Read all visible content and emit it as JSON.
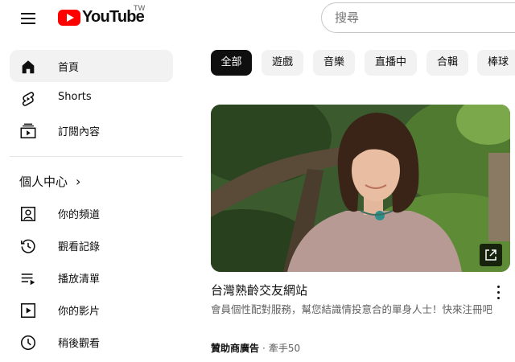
{
  "header": {
    "logo_text": "YouTube",
    "region": "TW",
    "search_placeholder": "搜尋"
  },
  "sidebar": {
    "items": [
      {
        "label": "首頁",
        "icon": "home-icon",
        "active": true
      },
      {
        "label": "Shorts",
        "icon": "shorts-icon",
        "active": false
      },
      {
        "label": "訂閱內容",
        "icon": "subscriptions-icon",
        "active": false
      }
    ],
    "you_heading": "個人中心",
    "you_items": [
      {
        "label": "你的頻道",
        "icon": "your-channel-icon"
      },
      {
        "label": "觀看記錄",
        "icon": "history-icon"
      },
      {
        "label": "播放清單",
        "icon": "playlists-icon"
      },
      {
        "label": "你的影片",
        "icon": "your-videos-icon"
      },
      {
        "label": "稍後觀看",
        "icon": "watch-later-icon"
      }
    ]
  },
  "chips": [
    "全部",
    "遊戲",
    "音樂",
    "直播中",
    "合輯",
    "棒球"
  ],
  "ad": {
    "title": "台灣熟齡交友網站",
    "description": "會員個性配對服務，幫您結識情投意合的單身人士！快來注冊吧",
    "sponsored": "贊助商廣告",
    "separator": "·",
    "advertiser": "牽手50"
  },
  "colors": {
    "accent_red": "#ff0000",
    "text_primary": "#0f0f0f",
    "text_secondary": "#606060",
    "chip_bg": "#f2f2f2",
    "chip_active_bg": "#0f0f0f"
  }
}
